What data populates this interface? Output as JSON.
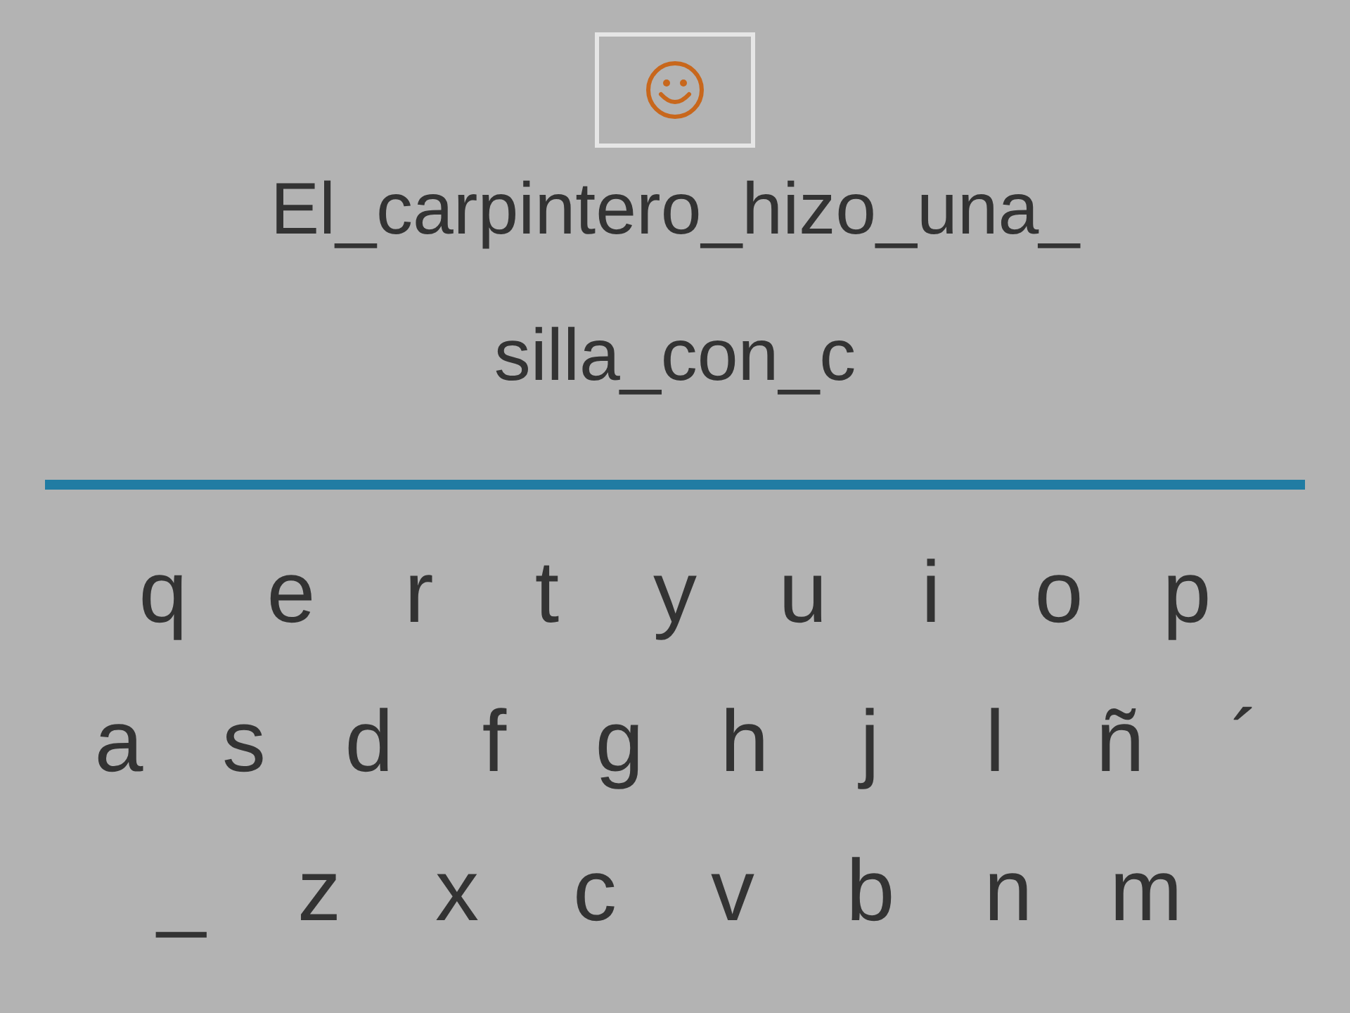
{
  "prompt_lines": [
    "El_carpintero_hizo_una_",
    "silla_con_c"
  ],
  "keyboard_rows": [
    [
      "q",
      "e",
      "r",
      "t",
      "y",
      "u",
      "i",
      "o",
      "p"
    ],
    [
      "a",
      "s",
      "d",
      "f",
      "g",
      "h",
      "j",
      "l",
      "ñ",
      "´"
    ],
    [
      "_",
      "z",
      "x",
      "c",
      "v",
      "b",
      "n",
      "m"
    ]
  ]
}
